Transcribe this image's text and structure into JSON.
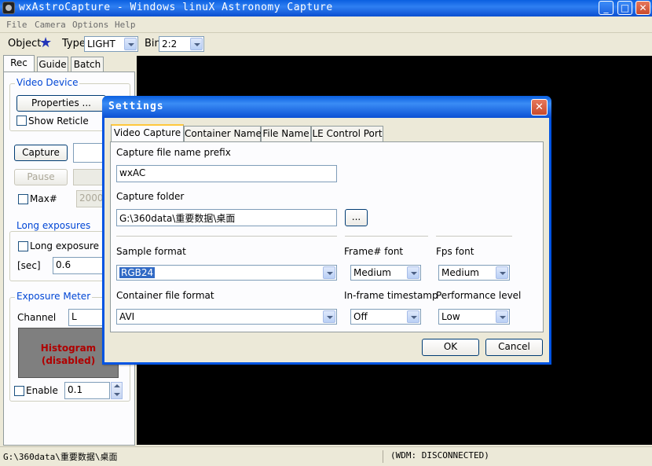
{
  "window": {
    "title": "wxAstroCapture - Windows linuX Astronomy Capture",
    "controls": [
      "_",
      "□",
      "✕"
    ]
  },
  "menu": [
    "File",
    "Camera",
    "Options",
    "Help"
  ],
  "toolbar": {
    "object_label": "Object",
    "object_icon": "star-icon",
    "type_label": "Type",
    "type_value": "LIGHT",
    "bin_label": "Bin",
    "bin_value": "2:2"
  },
  "left_panel": {
    "tabs": [
      "Rec",
      "Guide",
      "Batch"
    ],
    "video_device": {
      "title": "Video Device",
      "properties_button": "Properties ...",
      "show_reticle": "Show Reticle"
    },
    "capture_button": "Capture",
    "pause_button": "Pause",
    "max_label": "Max#",
    "max_value": "2000",
    "long_exposures": {
      "title": "Long exposures",
      "checkbox": "Long exposure",
      "sec_label": "[sec]",
      "sec_value": "0.6"
    },
    "exposure_meter": {
      "title": "Exposure Meter",
      "channel_label": "Channel",
      "channel_value": "L",
      "histogram_line1": "Histogram",
      "histogram_line2": "(disabled)",
      "enable_label": "Enable",
      "enable_value": "0.1"
    }
  },
  "status_bar": {
    "path": "G:\\360data\\重要数据\\桌面",
    "wdm": "(WDM: DISCONNECTED)"
  },
  "dialog": {
    "title": "Settings",
    "tabs": [
      "Video Capture",
      "Container Name",
      "File Name",
      "LE Control Port"
    ],
    "prefix_label": "Capture file name prefix",
    "prefix_value": "wxAC",
    "folder_label": "Capture folder",
    "folder_value": "G:\\360data\\重要数据\\桌面",
    "browse_button": "...",
    "sample_format_label": "Sample format",
    "sample_format_value": "RGB24",
    "frame_font_label": "Frame# font",
    "frame_font_value": "Medium",
    "fps_font_label": "Fps font",
    "fps_font_value": "Medium",
    "container_format_label": "Container file format",
    "container_format_value": "AVI",
    "timestamp_label": "In-frame timestamp",
    "timestamp_value": "Off",
    "performance_label": "Performance level",
    "performance_value": "Low",
    "ok_button": "OK",
    "cancel_button": "Cancel"
  },
  "colors": {
    "titlebar": "#0a5fe0",
    "group_title": "#0046d5",
    "histogram_text": "#b00000",
    "histogram_bg": "#7f7f7f"
  }
}
